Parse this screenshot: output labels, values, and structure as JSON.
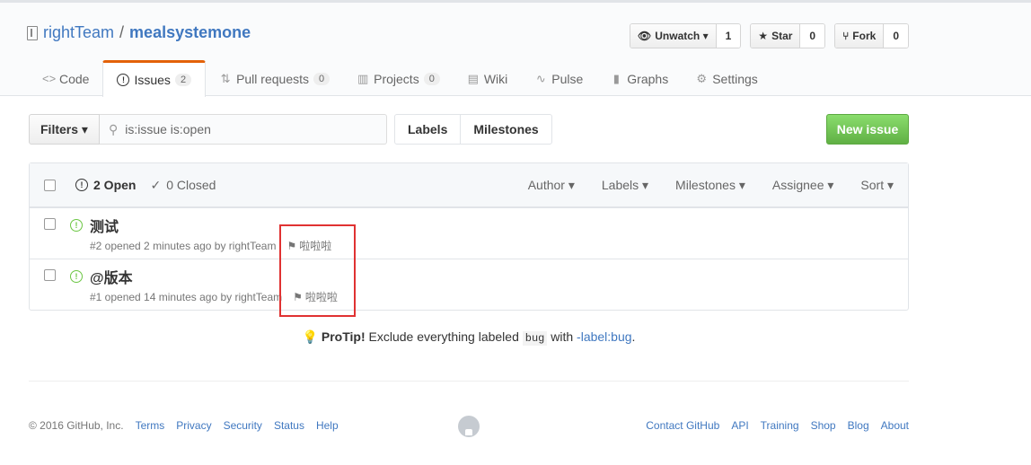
{
  "repo": {
    "owner": "rightTeam",
    "separator": "/",
    "name": "mealsystemone"
  },
  "actions": [
    {
      "label": "Unwatch ▾",
      "count": "1",
      "icon": "eye-icon"
    },
    {
      "label": "Star",
      "count": "0",
      "icon": "star-icon"
    },
    {
      "label": "Fork",
      "count": "0",
      "icon": "fork-icon"
    }
  ],
  "tabs": [
    {
      "label": "Code",
      "icon": "code-icon"
    },
    {
      "label": "Issues",
      "count": "2",
      "icon": "issue-icon",
      "selected": true
    },
    {
      "label": "Pull requests",
      "count": "0",
      "icon": "pull-request-icon"
    },
    {
      "label": "Projects",
      "count": "0",
      "icon": "project-icon"
    },
    {
      "label": "Wiki",
      "icon": "book-icon"
    },
    {
      "label": "Pulse",
      "icon": "pulse-icon"
    },
    {
      "label": "Graphs",
      "icon": "graph-icon"
    },
    {
      "label": "Settings",
      "icon": "gear-icon"
    }
  ],
  "filters": {
    "button": "Filters ▾",
    "search_value": "is:issue is:open"
  },
  "labelnav": {
    "labels": "Labels",
    "milestones": "Milestones"
  },
  "new_issue": "New issue",
  "list_header": {
    "open": "2 Open",
    "closed": "0 Closed",
    "filters": [
      "Author ▾",
      "Labels ▾",
      "Milestones ▾",
      "Assignee ▾",
      "Sort ▾"
    ]
  },
  "issues": [
    {
      "title": "测试",
      "meta": "#2 opened 2 minutes ago by rightTeam",
      "milestone": "啦啦啦"
    },
    {
      "title": "@版本",
      "meta": "#1 opened 14 minutes ago by rightTeam",
      "milestone": "啦啦啦"
    }
  ],
  "protip": {
    "label": "ProTip!",
    "text_before": " Exclude everything labeled ",
    "code": "bug",
    "text_mid": " with ",
    "link": "-label:bug",
    "text_after": "."
  },
  "footer": {
    "copyright": "© 2016 GitHub, Inc.",
    "left_links": [
      "Terms",
      "Privacy",
      "Security",
      "Status",
      "Help"
    ],
    "right_links": [
      "Contact GitHub",
      "API",
      "Training",
      "Shop",
      "Blog",
      "About"
    ]
  }
}
